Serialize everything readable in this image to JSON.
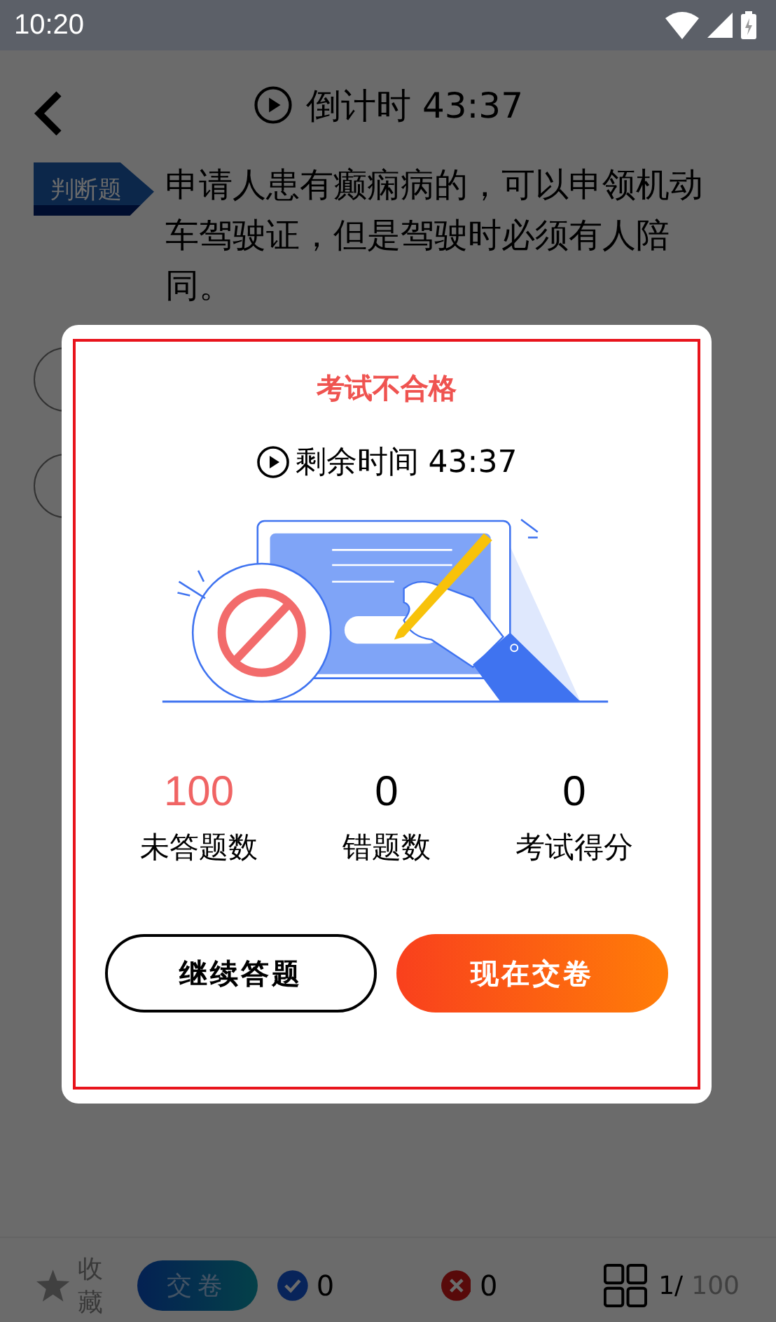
{
  "status_bar": {
    "time": "10:20"
  },
  "header": {
    "timer": "倒计时 43:37"
  },
  "question": {
    "tag": "判断题",
    "text": "申请人患有癫痫病的，可以申领机动车驾驶证，但是驾驶时必须有人陪同。"
  },
  "dialog": {
    "title": "考试不合格",
    "remaining": "剩余时间 43:37",
    "stats": [
      {
        "value": "100",
        "label": "未答题数",
        "highlight": true
      },
      {
        "value": "0",
        "label": "错题数",
        "highlight": false
      },
      {
        "value": "0",
        "label": "考试得分",
        "highlight": false
      }
    ],
    "buttons": [
      {
        "label": "继续答题",
        "kind": "outline"
      },
      {
        "label": "现在交卷",
        "kind": "primary"
      }
    ]
  },
  "bottom_bar": {
    "favorite": "收藏",
    "submit": "交卷",
    "correct_count": "0",
    "wrong_count": "0",
    "progress_current": "1/",
    "progress_total": "100"
  }
}
